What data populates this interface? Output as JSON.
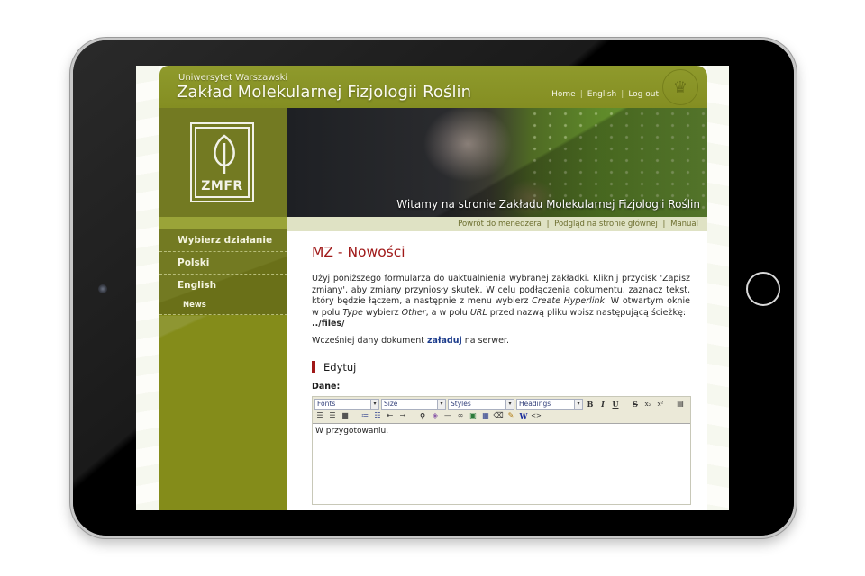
{
  "header": {
    "university": "Uniwersytet Warszawski",
    "department": "Zakład Molekularnej Fizjologii Roślin",
    "nav": [
      {
        "label": "Home"
      },
      {
        "label": "English"
      },
      {
        "label": "Log out"
      }
    ],
    "seal_icon": "university-seal"
  },
  "logo": {
    "text": "ZMFR",
    "icon": "leaf-icon"
  },
  "sidebar": {
    "items": [
      {
        "label": "Wybierz działanie"
      },
      {
        "label": "Polski"
      },
      {
        "label": "English"
      },
      {
        "label": "News"
      }
    ]
  },
  "banner": {
    "caption": "Witamy na stronie Zakładu Molekularnej Fizjologii Roślin"
  },
  "subnav": {
    "links": [
      {
        "label": "Powrót do menedżera"
      },
      {
        "label": "Podgląd na stronie głównej"
      },
      {
        "label": "Manual"
      }
    ]
  },
  "content": {
    "title": "MZ - Nowości",
    "intro": {
      "p1": "Użyj poniższego formularza do uaktualnienia wybranej zakładki. Kliknij przycisk 'Zapisz zmiany', aby zmiany przyniosły skutek. W celu podłączenia dokumentu, zaznacz tekst, który będzie łączem, a następnie z menu wybierz ",
      "em1": "Create Hyperlink",
      "p2": ". W otwartym oknie w polu ",
      "em2": "Type",
      "p3": " wybierz ",
      "em3": "Other",
      "p4": ", a w polu ",
      "em4": "URL",
      "p5": " przed nazwą pliku wpisz następującą ścieżkę: ",
      "path": "../files/"
    },
    "upload": {
      "before": "Wcześniej dany dokument ",
      "link": "załaduj",
      "after": " na serwer."
    },
    "section_title": "Edytuj",
    "field_label": "Dane:"
  },
  "editor": {
    "selects": [
      {
        "value": "Fonts"
      },
      {
        "value": "Size"
      },
      {
        "value": "Styles"
      },
      {
        "value": "Headings"
      }
    ],
    "row1_buttons": [
      {
        "name": "bold",
        "glyph": "B"
      },
      {
        "name": "italic",
        "glyph": "I"
      },
      {
        "name": "underline",
        "glyph": "U"
      },
      {
        "name": "strikethrough",
        "glyph": "S"
      },
      {
        "name": "subscript",
        "glyph": "x₂"
      },
      {
        "name": "superscript",
        "glyph": "x²"
      },
      {
        "name": "align-left",
        "glyph": "▤"
      }
    ],
    "row2_buttons": [
      {
        "name": "align-center",
        "glyph": "☰"
      },
      {
        "name": "align-right",
        "glyph": "☰"
      },
      {
        "name": "justify",
        "glyph": "■"
      },
      {
        "name": "ordered-list",
        "glyph": "≔"
      },
      {
        "name": "unordered-list",
        "glyph": "☷"
      },
      {
        "name": "outdent",
        "glyph": "⇤"
      },
      {
        "name": "indent",
        "glyph": "⇥"
      },
      {
        "name": "find",
        "glyph": "⚲"
      },
      {
        "name": "color",
        "glyph": "◈"
      },
      {
        "name": "horizontal-rule",
        "glyph": "—"
      },
      {
        "name": "hyperlink",
        "glyph": "∞"
      },
      {
        "name": "image",
        "glyph": "▣"
      },
      {
        "name": "table",
        "glyph": "▦"
      },
      {
        "name": "eraser",
        "glyph": "⌫"
      },
      {
        "name": "clean",
        "glyph": "✎"
      },
      {
        "name": "word-paste",
        "glyph": "W"
      },
      {
        "name": "source",
        "glyph": "<>"
      }
    ],
    "value": "W przygotowaniu."
  }
}
